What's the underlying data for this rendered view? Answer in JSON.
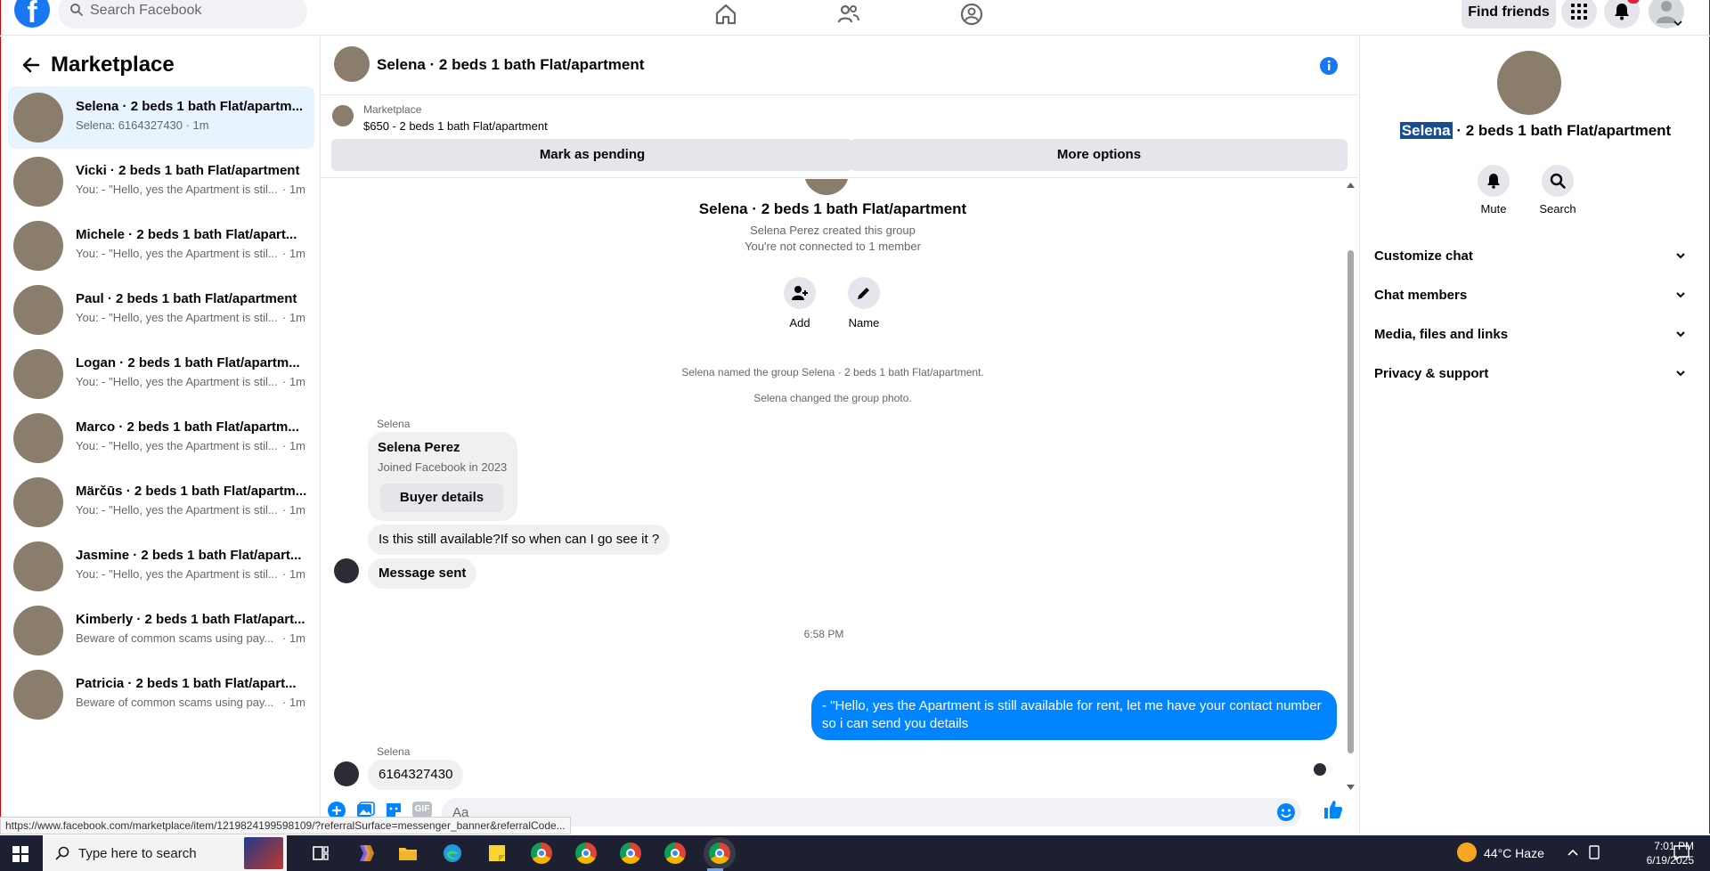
{
  "topbar": {
    "search_placeholder": "Search Facebook",
    "find_friends": "Find friends"
  },
  "sidebar": {
    "title": "Marketplace",
    "conversations": [
      {
        "name": "Selena · 2 beds 1 bath Flat/apartm...",
        "preview": "Selena: 6164327430 · 1m"
      },
      {
        "name": "Vicki · 2 beds 1 bath Flat/apartment",
        "preview": "You: - \"Hello, yes the Apartment is stil...",
        "time": "· 1m"
      },
      {
        "name": "Michele · 2 beds 1 bath Flat/apart...",
        "preview": "You: - \"Hello, yes the Apartment is stil...",
        "time": "· 1m"
      },
      {
        "name": "Paul · 2 beds 1 bath Flat/apartment",
        "preview": "You: - \"Hello, yes the Apartment is stil...",
        "time": "· 1m"
      },
      {
        "name": "Logan · 2 beds 1 bath Flat/apartm...",
        "preview": "You: - \"Hello, yes the Apartment is stil...",
        "time": "· 1m"
      },
      {
        "name": "Marco · 2 beds 1 bath Flat/apartm...",
        "preview": "You: - \"Hello, yes the Apartment is stil...",
        "time": "· 1m"
      },
      {
        "name": "Märčūs · 2 beds 1 bath Flat/apartm...",
        "preview": "You: - \"Hello, yes the Apartment is stil...",
        "time": "· 1m"
      },
      {
        "name": "Jasmine · 2 beds 1 bath Flat/apart...",
        "preview": "You: - \"Hello, yes the Apartment is stil...",
        "time": "· 1m"
      },
      {
        "name": "Kimberly · 2 beds 1 bath Flat/apart...",
        "preview": "Beware of common scams using pay...",
        "time": "· 1m"
      },
      {
        "name": "Patricia · 2 beds 1 bath Flat/apart...",
        "preview": "Beware of common scams using pay...",
        "time": "· 1m"
      }
    ]
  },
  "chat": {
    "title": "Selena · 2 beds 1 bath Flat/apartment",
    "marketplace_label": "Marketplace",
    "listing": "$650 - 2 beds 1 bath Flat/apartment",
    "mark_pending": "Mark as pending",
    "more_options": "More options",
    "group_title": "Selena · 2 beds 1 bath Flat/apartment",
    "created": "Selena Perez created this group",
    "not_connected": "You're not connected to 1 member",
    "add_label": "Add",
    "name_label": "Name",
    "sys1": "Selena named the group Selena · 2 beds 1 bath Flat/apartment.",
    "sys2": "Selena changed the group photo.",
    "sender1": "Selena",
    "buyer_name": "Selena Perez",
    "buyer_joined": "Joined Facebook in 2023",
    "buyer_details": "Buyer details",
    "msg1": "Is this still available?If so when can I go see it ?",
    "msg2": "Message sent",
    "time_sep": "6:58 PM",
    "out_msg": "-       \"Hello, yes the   Apartment is still available for rent, let me have your contact number so i can send you details",
    "sender2": "Selena",
    "msg3": "6164327430",
    "composer_placeholder": "Aa",
    "gif_label": "GIF"
  },
  "panel": {
    "title_highlight": "Selena",
    "title_rest": " · 2 beds 1 bath Flat/apartment",
    "mute": "Mute",
    "search": "Search",
    "sections": [
      "Customize chat",
      "Chat members",
      "Media, files and links",
      "Privacy & support"
    ]
  },
  "status_url": "https://www.facebook.com/marketplace/item/1219824199598109/?referralSurface=messenger_banner&referralCode...",
  "taskbar": {
    "search": "Type here to search",
    "temp": "44°C  Haze",
    "time": "7:01 PM",
    "date": "6/19/2025"
  },
  "colors": {
    "brand": "#1877f2",
    "outgoing": "#0084ff",
    "active_row": "#e7f3ff"
  }
}
